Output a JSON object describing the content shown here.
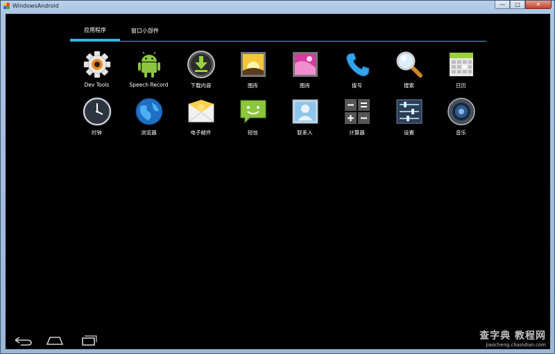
{
  "window": {
    "title": "WindowsAndroid",
    "buttons": {
      "minimize": "—",
      "maximize": "□",
      "close": "✕"
    }
  },
  "tabs": [
    {
      "label": "应用程序",
      "active": true
    },
    {
      "label": "窗口小部件",
      "active": false
    }
  ],
  "apps": [
    {
      "label": "Dev Tools",
      "icon": "gear-icon"
    },
    {
      "label": "Speech Record",
      "icon": "android-robot-icon"
    },
    {
      "label": "下载内容",
      "icon": "download-icon"
    },
    {
      "label": "图库",
      "icon": "gallery-icon"
    },
    {
      "label": "图库",
      "icon": "gallery-pink-icon"
    },
    {
      "label": "拨号",
      "icon": "phone-icon"
    },
    {
      "label": "搜索",
      "icon": "magnifier-icon"
    },
    {
      "label": "日历",
      "icon": "calendar-icon"
    },
    {
      "label": "时钟",
      "icon": "clock-icon"
    },
    {
      "label": "浏览器",
      "icon": "globe-icon"
    },
    {
      "label": "电子邮件",
      "icon": "email-icon"
    },
    {
      "label": "短信",
      "icon": "message-icon"
    },
    {
      "label": "联系人",
      "icon": "contacts-icon"
    },
    {
      "label": "计算器",
      "icon": "calculator-icon"
    },
    {
      "label": "设置",
      "icon": "settings-sliders-icon"
    },
    {
      "label": "音乐",
      "icon": "speaker-icon"
    }
  ],
  "navbar": {
    "back": "back-icon",
    "home": "home-icon",
    "recents": "recents-icon"
  },
  "watermark": {
    "main": "查字典 教程网",
    "sub": "jiaocheng.chazidian.com"
  },
  "colors": {
    "accent": "#33b5e5",
    "background": "#000000"
  }
}
